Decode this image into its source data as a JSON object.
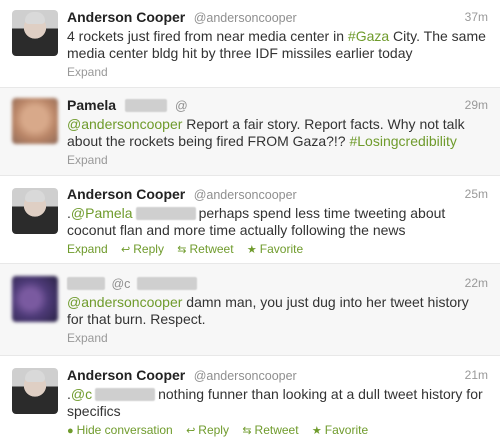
{
  "tweets": [
    {
      "name": "Anderson Cooper",
      "handle": "@andersoncooper",
      "time": "37m",
      "text_a": "4 rockets just fired from near media center in ",
      "hashtag": "#Gaza",
      "text_b": " City. The same media center bldg hit by three IDF missiles earlier today",
      "expand": "Expand"
    },
    {
      "name": "Pamela",
      "handle": "@",
      "time": "29m",
      "mention": "@andersoncooper",
      "text": " Report a fair story. Report facts. Why not talk about the rockets being fired FROM Gaza?!? ",
      "hashtag": "#Losingcredibility",
      "expand": "Expand"
    },
    {
      "name": "Anderson Cooper",
      "handle": "@andersoncooper",
      "time": "25m",
      "mention_prefix": ".",
      "mention": "@Pamela",
      "text": "perhaps spend less time tweeting about coconut flan and more time actually following the news",
      "expand": "Expand",
      "reply": "Reply",
      "retweet": "Retweet",
      "favorite": "Favorite"
    },
    {
      "handle": "@c",
      "time": "22m",
      "mention": "@andersoncooper",
      "text": " damn man, you just dug into her tweet history for that burn. Respect.",
      "expand": "Expand"
    },
    {
      "name": "Anderson Cooper",
      "handle": "@andersoncooper",
      "time": "21m",
      "mention_prefix": ".",
      "mention": "@c",
      "text": "nothing funner than looking at a dull tweet history for specifics",
      "hide": "Hide conversation",
      "reply": "Reply",
      "retweet": "Retweet",
      "favorite": "Favorite"
    }
  ],
  "colors": {
    "link": "#6f9b2c",
    "meta": "#999999",
    "name": "#222222"
  },
  "icons": [
    "reply-icon",
    "retweet-icon",
    "favorite-icon",
    "conversation-icon"
  ]
}
